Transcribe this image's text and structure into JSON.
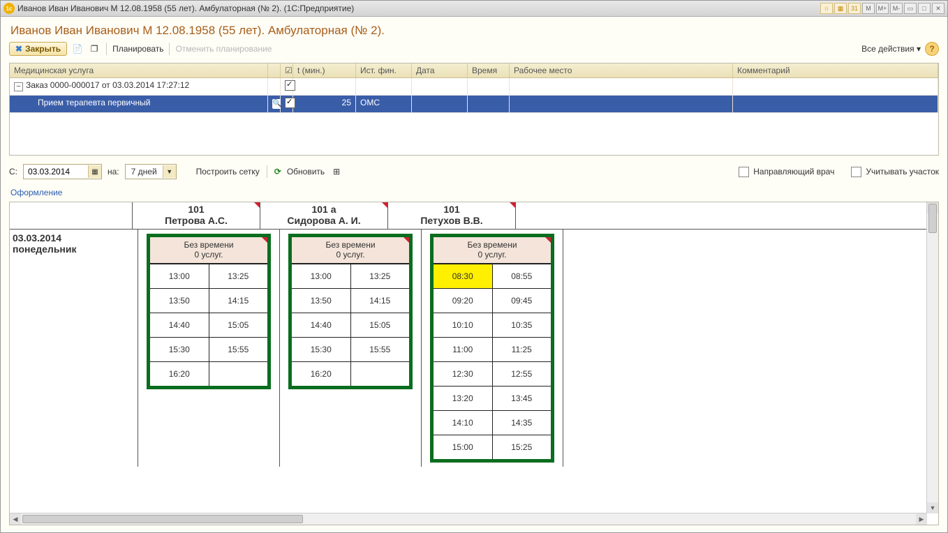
{
  "titlebar": {
    "icon_text": "1c",
    "text": "Иванов Иван Иванович М 12.08.1958 (55 лет). Амбулаторная (№ 2).  (1С:Предприятие)",
    "sys_buttons": [
      "☆",
      "▦",
      "31",
      "M",
      "M+",
      "M-",
      "▭",
      "□",
      "✕"
    ]
  },
  "page_title": "Иванов Иван Иванович М 12.08.1958 (55 лет). Амбулаторная (№ 2).",
  "toolbar": {
    "close_label": "Закрыть",
    "plan_label": "Планировать",
    "cancel_plan_label": "Отменить планирование",
    "all_actions_label": "Все действия ▾",
    "help": "?"
  },
  "grid": {
    "headers": {
      "service": "Медицинская услуга",
      "time": "t (мин.)",
      "fin": "Ист. фин.",
      "date": "Дата",
      "vtime": "Время",
      "workplace": "Рабочее место",
      "comment": "Комментарий"
    },
    "order_row": "Заказ 0000-000017 от 03.03.2014 17:27:12",
    "service_row": {
      "name": "Прием терапевта первичный",
      "minutes": "25",
      "fin": "ОМС"
    }
  },
  "filters": {
    "from_label": "С:",
    "from_value": "03.03.2014",
    "for_label": "на:",
    "period_value": "7 дней",
    "build_grid": "Построить сетку",
    "refresh": "Обновить",
    "referring_doctor": "Направляющий врач",
    "consider_area": "Учитывать участок"
  },
  "design_link": "Оформление",
  "schedule": {
    "resources": [
      {
        "room": "101",
        "doctor": "Петрова А.С."
      },
      {
        "room": "101 а",
        "doctor": "Сидорова А. И."
      },
      {
        "room": "101",
        "doctor": "Петухов В.В."
      }
    ],
    "date": "03.03.2014",
    "weekday": "понедельник",
    "no_time_header": {
      "l1": "Без времени",
      "l2": "0 услуг."
    },
    "cards": [
      {
        "slots": [
          [
            "13:00",
            "13:25"
          ],
          [
            "13:50",
            "14:15"
          ],
          [
            "14:40",
            "15:05"
          ],
          [
            "15:30",
            "15:55"
          ],
          [
            "16:20",
            ""
          ]
        ]
      },
      {
        "slots": [
          [
            "13:00",
            "13:25"
          ],
          [
            "13:50",
            "14:15"
          ],
          [
            "14:40",
            "15:05"
          ],
          [
            "15:30",
            "15:55"
          ],
          [
            "16:20",
            ""
          ]
        ]
      },
      {
        "slots": [
          [
            "08:30",
            "08:55"
          ],
          [
            "09:20",
            "09:45"
          ],
          [
            "10:10",
            "10:35"
          ],
          [
            "11:00",
            "11:25"
          ],
          [
            "12:30",
            "12:55"
          ],
          [
            "13:20",
            "13:45"
          ],
          [
            "14:10",
            "14:35"
          ],
          [
            "15:00",
            "15:25"
          ]
        ],
        "highlight": [
          0,
          0
        ]
      }
    ]
  }
}
